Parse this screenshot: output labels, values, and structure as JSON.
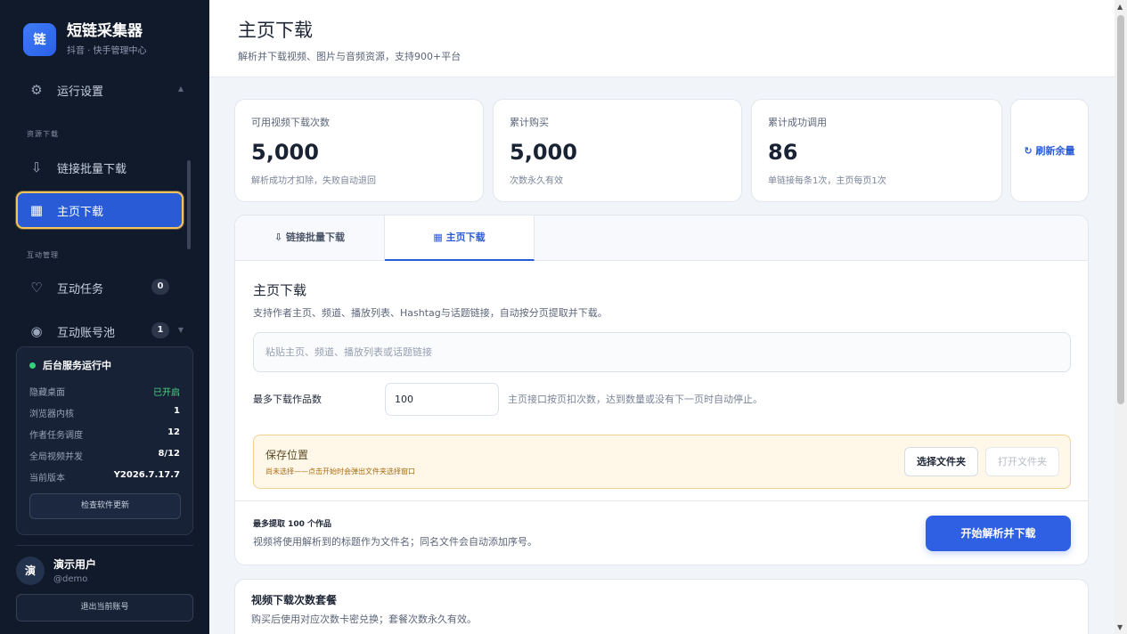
{
  "sidebar": {
    "brand": {
      "logo": "链",
      "title": "短链采集器",
      "subtitle": "抖音 · 快手管理中心"
    },
    "settings": {
      "label": "运行设置",
      "icon": "gear-icon"
    },
    "section_download": "资源下载",
    "items": [
      {
        "label": "链接批量下载",
        "icon": "download-arrow-icon"
      },
      {
        "label": "主页下载",
        "icon": "grid-icon",
        "active": true
      }
    ],
    "section_interact": "互动管理",
    "interact_items": [
      {
        "label": "互动任务",
        "badge": "0",
        "icon": "heart-icon"
      },
      {
        "label": "互动账号池",
        "badge": "1",
        "icon": "account-pool-icon"
      }
    ],
    "status": {
      "title": "后台服务运行中",
      "rows": [
        {
          "label": "隐藏桌面",
          "value": "已开启"
        },
        {
          "label": "浏览器内核",
          "value": "1"
        },
        {
          "label": "作者任务调度",
          "value": "12"
        },
        {
          "label": "全局视频并发",
          "value": "8/12"
        },
        {
          "label": "当前版本",
          "value": "Y2026.7.17.7"
        }
      ],
      "check_update": "检查软件更新"
    },
    "user": {
      "avatar": "演",
      "name": "演示用户",
      "handle": "@demo",
      "logout": "退出当前账号"
    }
  },
  "header": {
    "title": "主页下载",
    "subtitle": "解析并下载视频、图片与音频资源，支持900+平台"
  },
  "stats": [
    {
      "label": "可用视频下载次数",
      "value": "5,000",
      "note": "解析成功才扣除，失败自动退回"
    },
    {
      "label": "累计购买",
      "value": "5,000",
      "note": "次数永久有效"
    },
    {
      "label": "累计成功调用",
      "value": "86",
      "note": "单链接每条1次，主页每页1次"
    }
  ],
  "refresh": {
    "label": "↻ 刷新余量"
  },
  "tabs": [
    {
      "label": "⇩ 链接批量下载"
    },
    {
      "label": "▦ 主页下载",
      "active": true
    }
  ],
  "form": {
    "title": "主页下载",
    "desc": "支持作者主页、频道、播放列表、Hashtag与话题链接，自动按分页提取并下载。",
    "url_placeholder": "粘贴主页、频道、播放列表或话题链接",
    "url_value": "",
    "max_label": "最多下载作品数",
    "max_value": "100",
    "max_hint": "主页接口按页扣次数，达到数量或没有下一页时自动停止。",
    "save": {
      "title": "保存位置",
      "note": "尚未选择——点击开始时会弹出文件夹选择窗口",
      "choose": "选择文件夹",
      "open": "打开文件夹"
    },
    "footer": {
      "title": "最多提取 100 个作品",
      "desc": "视频将使用解析到的标题作为文件名；同名文件会自动添加序号。",
      "start": "开始解析并下载"
    }
  },
  "package": {
    "title": "视频下载次数套餐",
    "desc": "购买后使用对应次数卡密兑换；套餐次数永久有效。"
  },
  "colors": {
    "sidebar_bg": "#111a2b",
    "accent": "#2a5bd7",
    "active_border": "#f3c35c",
    "status_on": "#34d27b"
  }
}
